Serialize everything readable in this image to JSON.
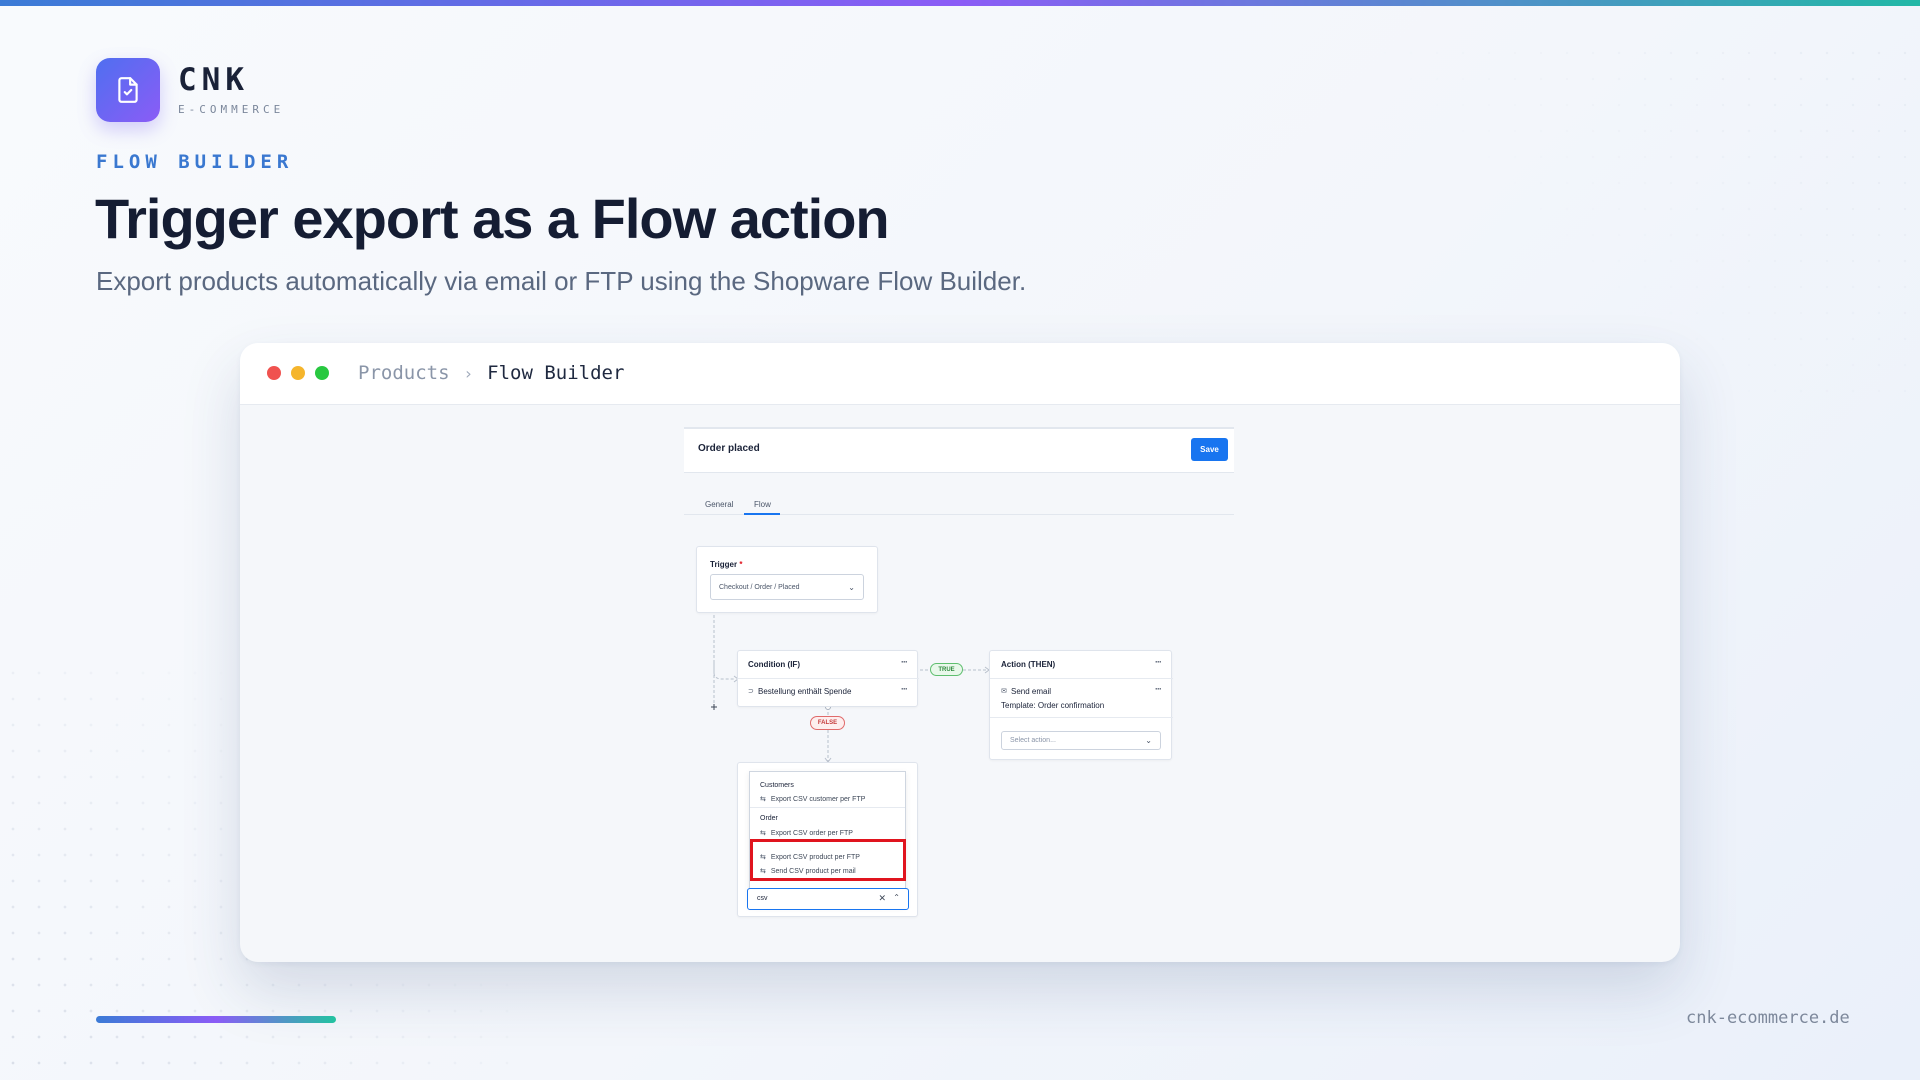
{
  "brand": {
    "name": "CNK",
    "tagline": "E-COMMERCE",
    "icon": "file-check-icon",
    "gradient": [
      "#4f6ff0",
      "#8b5cf6"
    ]
  },
  "hero": {
    "eyebrow": "FLOW BUILDER",
    "title": "Trigger export as a Flow action",
    "subtitle": "Export products automatically via email or FTP using the Shopware Flow Builder."
  },
  "window": {
    "breadcrumb": [
      "Products",
      "Flow Builder"
    ],
    "lights": [
      "#f0524f",
      "#f5b52c",
      "#28c840"
    ]
  },
  "flow": {
    "panel_title": "Order placed",
    "save_label": "Save",
    "tabs": [
      "General",
      "Flow"
    ],
    "active_tab": "Flow",
    "trigger": {
      "label": "Trigger",
      "required_mark": "*",
      "value": "Checkout / Order / Placed"
    },
    "condition": {
      "title": "Condition (IF)",
      "rule": "Bestellung enthält Spende"
    },
    "true_label": "TRUE",
    "false_label": "FALSE",
    "action": {
      "title": "Action (THEN)",
      "item": "Send email",
      "detail": "Template: Order confirmation",
      "select_placeholder": "Select action..."
    },
    "action_search": {
      "value": "csv",
      "groups": [
        {
          "name": "Customers",
          "items": [
            "Export CSV customer per FTP"
          ]
        },
        {
          "name": "Order",
          "items": [
            "Export CSV order per FTP"
          ]
        }
      ],
      "highlighted_items": [
        "Export CSV product per FTP",
        "Send CSV product per mail"
      ],
      "highlight_color": "#e0141e"
    },
    "accent": "#1875f0"
  },
  "footer": {
    "url": "cnk-ecommerce.de"
  }
}
